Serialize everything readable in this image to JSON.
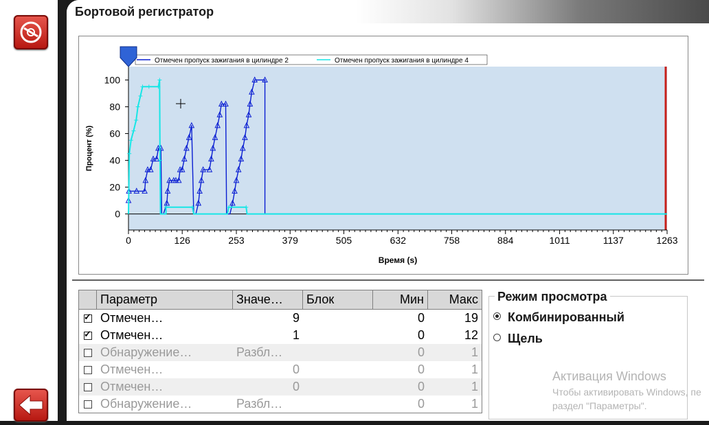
{
  "header": {
    "title": "Бортовой регистратор"
  },
  "colors": {
    "series1": "#0a1ed2",
    "series2": "#17e6e6",
    "plot_bg": "#cfe0f0",
    "accent_red": "#c8201a"
  },
  "chart_data": {
    "type": "line",
    "xlabel": "Время (s)",
    "ylabel": "Процент (%)",
    "x_ticks": [
      0,
      126,
      253,
      379,
      505,
      632,
      758,
      884,
      1011,
      1137,
      1263
    ],
    "y_ticks": [
      0,
      20,
      40,
      60,
      80,
      100
    ],
    "xlim": [
      0,
      1263
    ],
    "ylim": [
      -12,
      110
    ],
    "grid": false,
    "legend_position": "top",
    "series": [
      {
        "name": "Отмечен пропуск зажигания в цилиндре 2",
        "color": "#0a1ed2",
        "points": [
          [
            0,
            10
          ],
          [
            1,
            17
          ],
          [
            19,
            17
          ],
          [
            38,
            17
          ],
          [
            40,
            25
          ],
          [
            45,
            33
          ],
          [
            52,
            33
          ],
          [
            58,
            41
          ],
          [
            66,
            41
          ],
          [
            70,
            49
          ],
          [
            76,
            49
          ],
          [
            78,
            0
          ],
          [
            82,
            0
          ],
          [
            90,
            8
          ],
          [
            92,
            17
          ],
          [
            96,
            25
          ],
          [
            106,
            25
          ],
          [
            111,
            25
          ],
          [
            118,
            25
          ],
          [
            121,
            33
          ],
          [
            126,
            33
          ],
          [
            131,
            41
          ],
          [
            136,
            49
          ],
          [
            142,
            57
          ],
          [
            148,
            66
          ],
          [
            153,
            0
          ],
          [
            158,
            0
          ],
          [
            164,
            8
          ],
          [
            167,
            17
          ],
          [
            171,
            25
          ],
          [
            175,
            33
          ],
          [
            190,
            33
          ],
          [
            194,
            41
          ],
          [
            198,
            49
          ],
          [
            203,
            57
          ],
          [
            209,
            66
          ],
          [
            214,
            74
          ],
          [
            218,
            82
          ],
          [
            228,
            82
          ],
          [
            230,
            0
          ],
          [
            238,
            0
          ],
          [
            244,
            8
          ],
          [
            249,
            17
          ],
          [
            253,
            25
          ],
          [
            258,
            33
          ],
          [
            264,
            41
          ],
          [
            268,
            49
          ],
          [
            273,
            57
          ],
          [
            277,
            66
          ],
          [
            282,
            74
          ],
          [
            285,
            82
          ],
          [
            289,
            91
          ],
          [
            296,
            100
          ],
          [
            320,
            100
          ],
          [
            320,
            0
          ],
          [
            1263,
            0
          ]
        ]
      },
      {
        "name": "Отмечен пропуск зажигания в цилиндре 4",
        "color": "#17e6e6",
        "points": [
          [
            0,
            0
          ],
          [
            2,
            45
          ],
          [
            6,
            55
          ],
          [
            12,
            62
          ],
          [
            18,
            70
          ],
          [
            22,
            80
          ],
          [
            28,
            88
          ],
          [
            33,
            95
          ],
          [
            48,
            95
          ],
          [
            70,
            95
          ],
          [
            73,
            100
          ],
          [
            74,
            40
          ],
          [
            75,
            0
          ],
          [
            88,
            0
          ],
          [
            88,
            5
          ],
          [
            150,
            5
          ],
          [
            153,
            0
          ],
          [
            232,
            0
          ],
          [
            235,
            5
          ],
          [
            276,
            5
          ],
          [
            278,
            0
          ],
          [
            320,
            0
          ],
          [
            1263,
            0
          ]
        ]
      }
    ]
  },
  "table": {
    "headers": [
      "Параметр",
      "Значе…",
      "Блок",
      "Мин",
      "Макс"
    ],
    "rows": [
      {
        "param": "Отмечен…",
        "value": "9",
        "block": "",
        "min": "0",
        "max": "19"
      },
      {
        "param": "Отмечен…",
        "value": "1",
        "block": "",
        "min": "0",
        "max": "12"
      },
      {
        "param": "Обнаружение…",
        "value": "Разбл…",
        "block": "",
        "min": "0",
        "max": "1"
      },
      {
        "param": "Отмечен…",
        "value": "0",
        "block": "",
        "min": "0",
        "max": "1"
      },
      {
        "param": "Отмечен…",
        "value": "0",
        "block": "",
        "min": "0",
        "max": "1"
      },
      {
        "param": "Обнаружение…",
        "value": "Разбл…",
        "block": "",
        "min": "0",
        "max": "1"
      }
    ]
  },
  "view_mode": {
    "title": "Режим просмотра",
    "options": [
      "Комбинированный",
      "Щель"
    ],
    "selected": "Комбинированный"
  },
  "watermark": {
    "line1": "Активация Windows",
    "line2": "Чтобы активировать Windows, пе",
    "line3": "раздел \"Параметры\"."
  }
}
